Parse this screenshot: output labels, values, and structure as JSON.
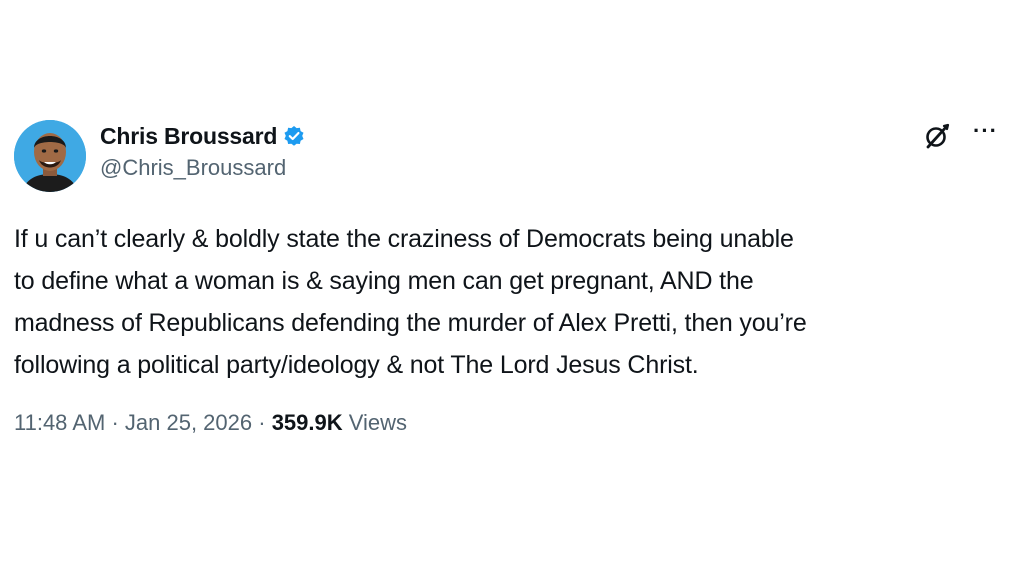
{
  "author": {
    "display_name": "Chris Broussard",
    "handle": "@Chris_Broussard",
    "verified": true,
    "avatar_icon": "avatar-portrait"
  },
  "actions": {
    "grok_icon": "grok-icon",
    "more_label": "···"
  },
  "tweet": {
    "lines": [
      "If u can’t clearly & boldly state the craziness of Democrats being unable",
      "to define what a woman is & saying men can get pregnant, AND the",
      "madness of Republicans defending the murder of Alex Pretti, then you’re",
      "following a political party/ideology & not The Lord Jesus Christ."
    ]
  },
  "meta": {
    "time": "11:48 AM",
    "separator": " · ",
    "date": "Jan 25, 2026",
    "views_count": "359.9K",
    "views_label": " Views"
  },
  "colors": {
    "text": "#0f1419",
    "secondary": "#536471",
    "verified_blue": "#1d9bf0",
    "avatar_bg": "#3fa9e4"
  }
}
